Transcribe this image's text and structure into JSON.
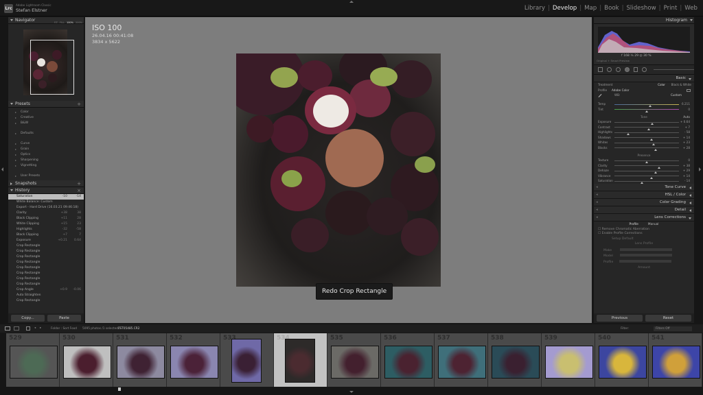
{
  "top": {
    "app_name": "Adobe Lightroom Classic",
    "user": "Stefan Elstner",
    "logo": "Lrc",
    "modules": [
      "Library",
      "Develop",
      "Map",
      "Book",
      "Slideshow",
      "Print",
      "Web"
    ],
    "active": "Develop"
  },
  "navigator": {
    "title": "Navigator",
    "zoom": [
      "FIT",
      "FILL",
      "100%",
      "200%"
    ],
    "zoom_active": "100%"
  },
  "presets": {
    "title": "Presets",
    "groups1": [
      "Color",
      "Creative",
      "B&W"
    ],
    "groups2": [
      "Defaults"
    ],
    "groups3": [
      "Curve",
      "Grain",
      "Optics",
      "Sharpening",
      "Vignetting"
    ],
    "groups4": [
      "User Presets"
    ]
  },
  "snapshots": {
    "title": "Snapshots"
  },
  "history": {
    "title": "History",
    "items": [
      {
        "l": "Saturation",
        "a": "-10",
        "b": "-14",
        "sel": true
      },
      {
        "l": "White Balance: Custom",
        "a": "",
        "b": ""
      },
      {
        "l": "Export - Hard Drive (16.03.21 09:46:18)",
        "a": "",
        "b": ""
      },
      {
        "l": "Clarity",
        "a": "+38",
        "b": "38"
      },
      {
        "l": "Black Clipping",
        "a": "+11",
        "b": "28"
      },
      {
        "l": "White Clipping",
        "a": "+15",
        "b": "23"
      },
      {
        "l": "Highlights",
        "a": "-32",
        "b": "-58"
      },
      {
        "l": "Black Clipping",
        "a": "+7",
        "b": "7"
      },
      {
        "l": "Exposure",
        "a": "+0.21",
        "b": "0.64"
      },
      {
        "l": "Crop Rectangle",
        "a": "",
        "b": ""
      },
      {
        "l": "Crop Rectangle",
        "a": "",
        "b": ""
      },
      {
        "l": "Crop Rectangle",
        "a": "",
        "b": ""
      },
      {
        "l": "Crop Rectangle",
        "a": "",
        "b": ""
      },
      {
        "l": "Crop Rectangle",
        "a": "",
        "b": ""
      },
      {
        "l": "Crop Rectangle",
        "a": "",
        "b": ""
      },
      {
        "l": "Crop Rectangle",
        "a": "",
        "b": ""
      },
      {
        "l": "Crop Rectangle",
        "a": "",
        "b": ""
      },
      {
        "l": "Crop Angle",
        "a": "+0.9",
        "b": "-0.06"
      },
      {
        "l": "Auto Straighten",
        "a": "",
        "b": ""
      },
      {
        "l": "Crop Rectangle",
        "a": "",
        "b": ""
      }
    ]
  },
  "left_buttons": {
    "copy": "Copy...",
    "paste": "Paste"
  },
  "photo_info": {
    "iso": "ISO 100",
    "date": "26.04.16 00:41:08",
    "size": "3834 x 5622"
  },
  "toast": "Redo Crop Rectangle",
  "histogram": {
    "title": "Histogram",
    "values": "f  168  ⅙  29  ◎  30 %",
    "original": "Original + Smart Preview"
  },
  "basic": {
    "title": "Basic",
    "treatment": "Treatment",
    "color": "Color",
    "bw": "Black & White",
    "profile_label": "Profile",
    "profile": "Adobe Color",
    "wb": "WB:",
    "wb_val": "Custom",
    "tone": "Tone",
    "auto": "Auto",
    "presence": "Presence",
    "sliders": [
      {
        "n": "Temp",
        "v": "6.211",
        "p": 0.55
      },
      {
        "n": "Tint",
        "v": "0",
        "p": 0.5
      },
      {
        "n": "Exposure",
        "v": "+ 0.64",
        "p": 0.58
      },
      {
        "n": "Contrast",
        "v": "+ 7",
        "p": 0.53
      },
      {
        "n": "Highlights",
        "v": "- 58",
        "p": 0.21
      },
      {
        "n": "Shadows",
        "v": "+ 14",
        "p": 0.57
      },
      {
        "n": "Whites",
        "v": "+ 23",
        "p": 0.61
      },
      {
        "n": "Blacks",
        "v": "+ 28",
        "p": 0.64
      },
      {
        "n": "Texture",
        "v": "0",
        "p": 0.5
      },
      {
        "n": "Clarity",
        "v": "+ 38",
        "p": 0.69
      },
      {
        "n": "Dehaze",
        "v": "+ 29",
        "p": 0.64
      },
      {
        "n": "Vibrance",
        "v": "+ 14",
        "p": 0.57
      },
      {
        "n": "Saturation",
        "v": "- 14",
        "p": 0.43
      }
    ]
  },
  "sections": [
    "Tone Curve",
    "HSL / Color",
    "Color Grading",
    "Detail",
    "Lens Corrections"
  ],
  "lens": {
    "tabs": [
      "Profile",
      "Manual"
    ],
    "opt1": "Remove Chromatic Aberration",
    "opt2": "Enable Profile Corrections",
    "setup": "Setup",
    "setup_val": "Default",
    "profile_lbl": "Lens Profile",
    "make": "Make",
    "model": "Model",
    "profile": "Profile",
    "amount": "Amount"
  },
  "right_buttons": {
    "previous": "Previous",
    "reset": "Reset"
  },
  "fsbar": {
    "source": "Folder : Sort Food",
    "count": "5095 photos /1 selected /",
    "file": "FST05485.CR2",
    "filter": "Filter:",
    "filter_val": "Filters Off"
  },
  "film": [
    {
      "n": "529",
      "c1": "#555",
      "c2": "#4d6a55",
      "w": 78
    },
    {
      "n": "530",
      "c1": "#bfbfbf",
      "c2": "#4b1e2e",
      "w": 78
    },
    {
      "n": "531",
      "c1": "#8d8aa0",
      "c2": "#3f2233",
      "w": 78
    },
    {
      "n": "532",
      "c1": "#8a86b0",
      "c2": "#4b2238",
      "w": 78
    },
    {
      "n": "533",
      "c1": "#6f69a7",
      "c2": "#3a2034",
      "w": 78
    },
    {
      "n": "534",
      "c1": "#2d2a29",
      "c2": "#4b2b30",
      "w": 78,
      "sel": true
    },
    {
      "n": "535",
      "c1": "#6b6a66",
      "c2": "#43202e",
      "w": 78
    },
    {
      "n": "536",
      "c1": "#2d5d63",
      "c2": "#4a2230",
      "w": 78
    },
    {
      "n": "537",
      "c1": "#3f6f7a",
      "c2": "#4d2332",
      "w": 78
    },
    {
      "n": "538",
      "c1": "#2a4b57",
      "c2": "#3a2030",
      "w": 78
    },
    {
      "n": "539",
      "c1": "#a49bd0",
      "c2": "#c9bf70",
      "w": 78
    },
    {
      "n": "540",
      "c1": "#3c46a0",
      "c2": "#d8b63c",
      "w": 78
    },
    {
      "n": "541",
      "c1": "#3d45a8",
      "c2": "#d0a03a",
      "w": 78
    }
  ]
}
